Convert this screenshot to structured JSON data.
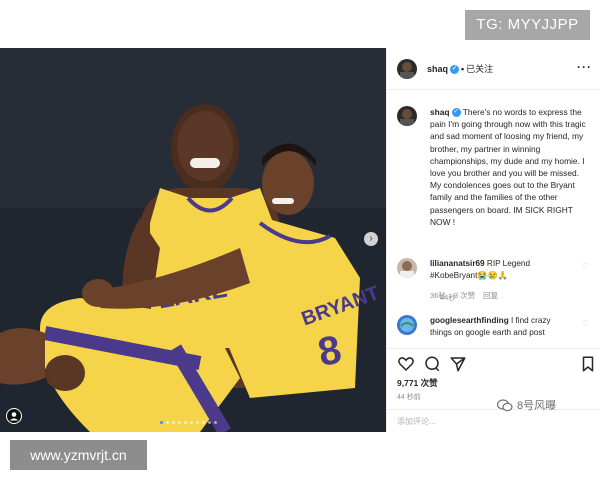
{
  "watermark_top": "TG: MYYJJPP",
  "watermark_bottom": "www.yzmvrjt.cn",
  "wechat_mark": "8号风曝",
  "photo": {
    "description_icon": "basketball-players-photo",
    "jersey_front": "LAKERS",
    "jersey_back": "BRYANT",
    "jersey_number": "8"
  },
  "header": {
    "username": "shaq",
    "follow_status": "已关注",
    "separator": "•",
    "more": "···"
  },
  "caption": {
    "username": "shaq",
    "text": "There's no words to express the pain I'm going through now with this tragic and sad moment of loosing my friend, my brother, my partner in winning championships, my dude and my homie. I love you brother and you will be missed. My condolences goes out to the Bryant family and the families of the other passengers on board. IM SICK RIGHT NOW !",
    "time": "44秒"
  },
  "comments": [
    {
      "username": "liliananatsir69",
      "text": "RIP Legend #KobeBryant😭😢🙏",
      "time": "36秒",
      "likes": "3 次赞",
      "reply": "回复"
    },
    {
      "username": "googlesearthfinding",
      "text": "I find crazy things on google earth and post"
    }
  ],
  "actions": {
    "likes": "9,771 次赞",
    "time": "44 秒前",
    "add_comment_placeholder": "添加评论..."
  },
  "colors": {
    "accent": "#3897f0",
    "jersey_gold": "#f5d44a",
    "jersey_purple": "#4b3a8c",
    "photo_bg": "#20262f"
  }
}
